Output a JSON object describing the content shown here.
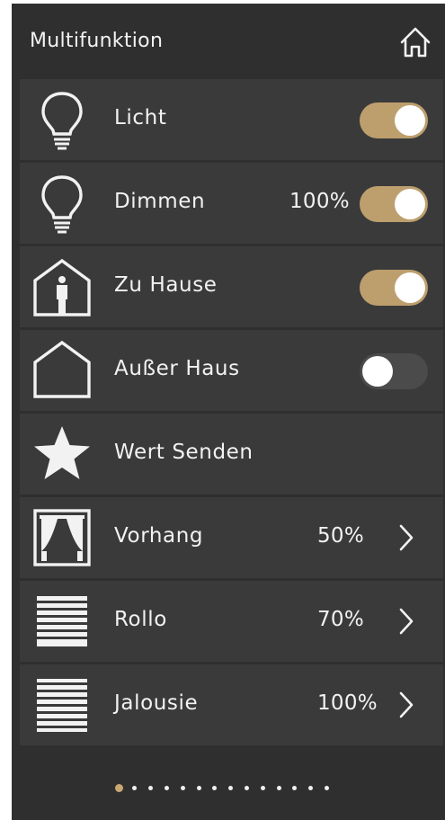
{
  "header": {
    "title": "Multifunktion",
    "home_icon": "home-icon"
  },
  "rows": [
    {
      "icon": "lightbulb-icon",
      "label": "Licht",
      "control": "toggle",
      "state": "on"
    },
    {
      "icon": "lightbulb-icon",
      "label": "Dimmen",
      "value": "100%",
      "control": "toggle",
      "state": "on"
    },
    {
      "icon": "house-person-icon",
      "label": "Zu Hause",
      "control": "toggle",
      "state": "on"
    },
    {
      "icon": "house-outline-icon",
      "label": "Außer Haus",
      "control": "toggle",
      "state": "off"
    },
    {
      "icon": "star-icon",
      "label": "Wert Senden"
    },
    {
      "icon": "curtain-icon",
      "label": "Vorhang",
      "value": "50%",
      "control": "chevron"
    },
    {
      "icon": "roller-shutter-icon",
      "label": "Rollo",
      "value": "70%",
      "control": "chevron"
    },
    {
      "icon": "venetian-blind-icon",
      "label": "Jalousie",
      "value": "100%",
      "control": "chevron"
    }
  ],
  "pager": {
    "pages": 14,
    "active_index": 0
  },
  "colors": {
    "accent": "#bd9f6e",
    "row_bg": "#3a3a3a",
    "panel_bg": "#2f2f2f",
    "toggle_off": "#4b4b4b"
  }
}
